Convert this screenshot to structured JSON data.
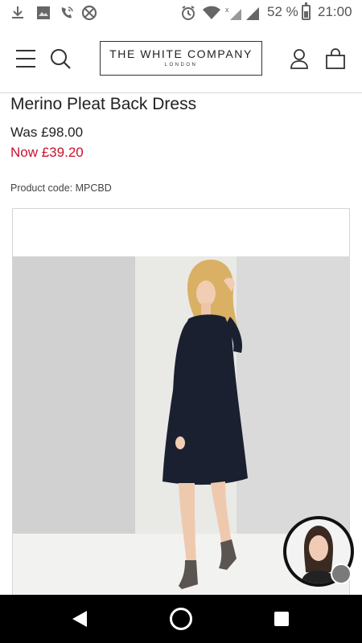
{
  "status_bar": {
    "battery_percent": "52 %",
    "time": "21:00",
    "icons": [
      "download-icon",
      "gallery-icon",
      "wifi-call-icon",
      "data-saver-icon",
      "alarm-icon",
      "wifi-icon",
      "signal-icon",
      "battery-icon"
    ],
    "battery_level": 0.52
  },
  "header": {
    "logo_main": "THE WHITE COMPANY",
    "logo_sub": "LONDON",
    "icons": [
      "menu-icon",
      "search-icon",
      "account-icon",
      "bag-icon"
    ]
  },
  "product": {
    "title": "Merino Pleat Back Dress",
    "price_was": "Was £98.00",
    "price_now": "Now £39.20",
    "product_code": "Product code: MPCBD"
  },
  "colors": {
    "sale_red": "#c8102e",
    "dress_navy": "#1a2030",
    "text": "#222222"
  },
  "nav_bar": {
    "icons": [
      "back-icon",
      "home-icon",
      "recents-icon"
    ]
  }
}
